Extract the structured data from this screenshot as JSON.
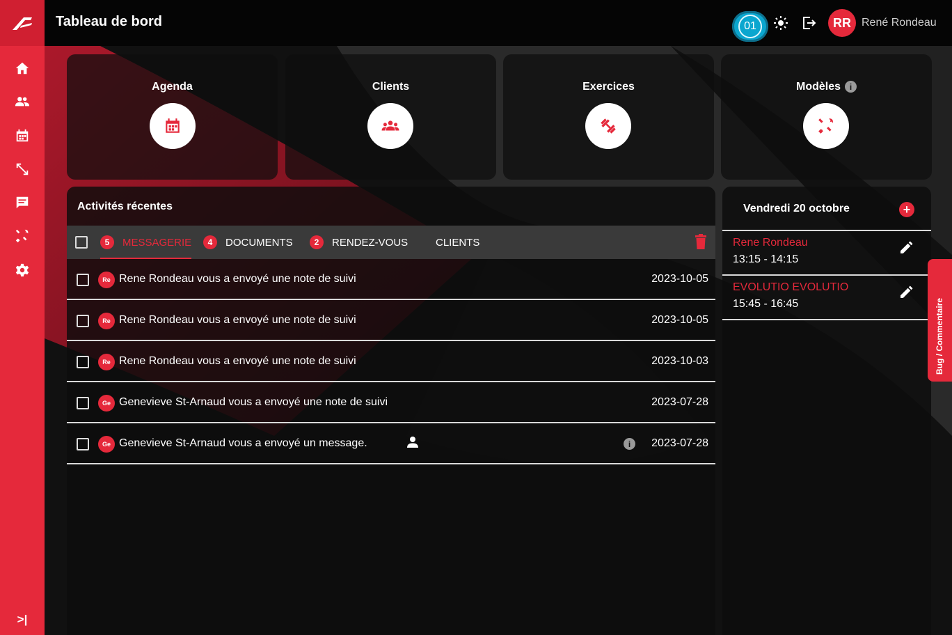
{
  "header": {
    "title": "Tableau de bord",
    "badge": "01",
    "user_initials": "RR",
    "user_name": "René Rondeau"
  },
  "sidebar": {
    "items": [
      "home-icon",
      "users-icon",
      "calendar-icon",
      "exercise-icon",
      "messages-icon",
      "tools-icon",
      "settings-icon"
    ],
    "collapse": ">|"
  },
  "cards": [
    {
      "title": "Agenda",
      "icon": "calendar-icon"
    },
    {
      "title": "Clients",
      "icon": "group-icon"
    },
    {
      "title": "Exercices",
      "icon": "dumbbell-icon"
    },
    {
      "title": "Modèles",
      "icon": "tools-icon",
      "info": "i"
    }
  ],
  "activities": {
    "title": "Activités récentes",
    "tabs": [
      {
        "count": "5",
        "label": "MESSAGERIE"
      },
      {
        "count": "4",
        "label": "DOCUMENTS"
      },
      {
        "count": "2",
        "label": "RENDEZ-VOUS"
      },
      {
        "count": "",
        "label": "CLIENTS"
      }
    ],
    "rows": [
      {
        "avatar": "Re",
        "text": "Rene Rondeau vous a envoyé une note de suivi",
        "date": "2023-10-05"
      },
      {
        "avatar": "Re",
        "text": "Rene Rondeau vous a envoyé une note de suivi",
        "date": "2023-10-05"
      },
      {
        "avatar": "Re",
        "text": "Rene Rondeau vous a envoyé une note de suivi",
        "date": "2023-10-03"
      },
      {
        "avatar": "Ge",
        "text": "Genevieve St-Arnaud vous a envoyé une note de suivi",
        "date": "2023-07-28"
      },
      {
        "avatar": "Ge",
        "text": "Genevieve St-Arnaud vous a envoyé un message.",
        "date": "2023-07-28",
        "info": "i"
      }
    ]
  },
  "agenda": {
    "title": "Vendredi 20 octobre",
    "add": "+",
    "appointments": [
      {
        "name": "Rene Rondeau",
        "time": "13:15 - 14:15"
      },
      {
        "name": "EVOLUTIO EVOLUTIO",
        "time": "15:45 - 16:45"
      }
    ]
  },
  "feedback": {
    "label": "Bug / Commentaire"
  },
  "colors": {
    "accent": "#e5293b",
    "dark": "#0b0b0b",
    "tabbar": "#3a3a3a",
    "badge": "#0aa6cf"
  }
}
